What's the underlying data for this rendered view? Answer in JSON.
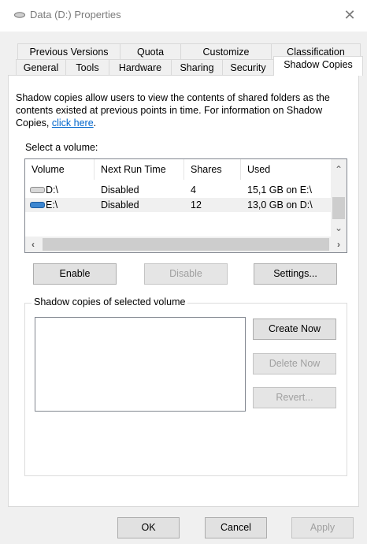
{
  "window": {
    "title": "Data (D:) Properties",
    "title_icon": "drive-icon",
    "close_icon": "close-icon"
  },
  "tabs": {
    "row1": [
      "Previous Versions",
      "Quota",
      "Customize",
      "Classification"
    ],
    "row2": [
      "General",
      "Tools",
      "Hardware",
      "Sharing",
      "Security",
      "Shadow Copies"
    ],
    "active": "Shadow Copies"
  },
  "description": {
    "text": "Shadow copies allow users to view the contents of shared folders as the contents existed at previous points in time. For information on Shadow Copies, ",
    "link": "click here",
    "end": "."
  },
  "select_volume_label": "Select a volume:",
  "volumes": {
    "columns": [
      "Volume",
      "Next Run Time",
      "Shares",
      "Used"
    ],
    "rows": [
      {
        "icon": "drive-gray-icon",
        "volume": "D:\\",
        "next_run": "Disabled",
        "shares": "4",
        "used": "15,1 GB on E:\\"
      },
      {
        "icon": "drive-blue-icon",
        "volume": "E:\\",
        "next_run": "Disabled",
        "shares": "12",
        "used": "13,0 GB on D:\\"
      }
    ],
    "selected_row": 1
  },
  "buttons": {
    "enable": "Enable",
    "disable": "Disable",
    "settings": "Settings...",
    "create_now": "Create Now",
    "delete_now": "Delete Now",
    "revert": "Revert...",
    "ok": "OK",
    "cancel": "Cancel",
    "apply": "Apply"
  },
  "shadow_copies_group_label": "Shadow copies of selected volume",
  "colors": {
    "accent_link": "#0066cc",
    "disabled_text": "#a0a0a0"
  }
}
